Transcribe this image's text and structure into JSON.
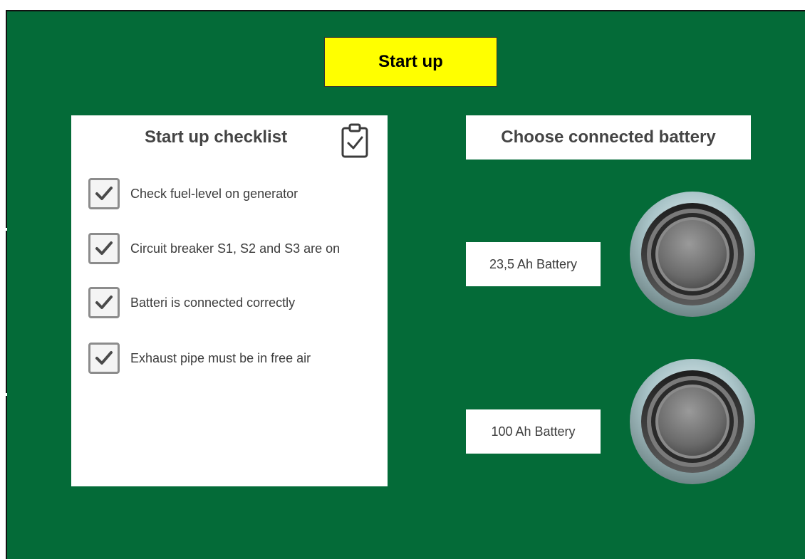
{
  "header": {
    "title": "Start up"
  },
  "checklist": {
    "title": "Start up checklist",
    "icon": "clipboard-check-icon",
    "items": [
      {
        "label": "Check fuel-level on generator",
        "checked": true
      },
      {
        "label": "Circuit breaker S1, S2 and S3 are on",
        "checked": true
      },
      {
        "label": "Batteri is connected correctly",
        "checked": true
      },
      {
        "label": "Exhaust pipe must be in free air",
        "checked": true
      }
    ]
  },
  "battery": {
    "heading": "Choose connected battery",
    "options": [
      {
        "label": "23,5 Ah Battery"
      },
      {
        "label": "100 Ah Battery"
      }
    ]
  },
  "colors": {
    "background": "#046b38",
    "title_box": "#ffff00",
    "panel": "#ffffff",
    "text": "#444444"
  }
}
